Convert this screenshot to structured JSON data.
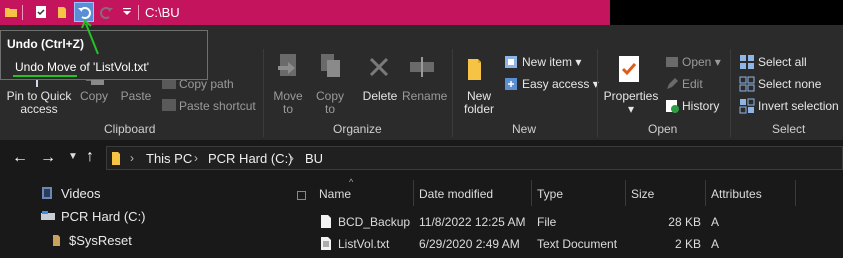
{
  "title_bar": {
    "path": "C:\\BU"
  },
  "tooltip": {
    "title": "Undo (Ctrl+Z)",
    "body_prefix": "Undo Move",
    "body_suffix": " of 'ListVol.txt'"
  },
  "ribbon": {
    "clipboard": {
      "pin_line1": "Pin to Quick",
      "pin_line2": "access",
      "copy": "Copy",
      "paste": "Paste",
      "copy_path": "Copy path",
      "paste_shortcut": "Paste shortcut",
      "group_label": "Clipboard"
    },
    "organize": {
      "move_to_1": "Move",
      "move_to_2": "to",
      "copy_to_1": "Copy",
      "copy_to_2": "to",
      "delete": "Delete",
      "rename": "Rename",
      "group_label": "Organize"
    },
    "new": {
      "new_folder_1": "New",
      "new_folder_2": "folder",
      "new_item": "New item",
      "easy_access": "Easy access",
      "group_label": "New"
    },
    "open": {
      "properties": "Properties",
      "open": "Open",
      "edit": "Edit",
      "history": "History",
      "group_label": "Open"
    },
    "select": {
      "select_all": "Select all",
      "select_none": "Select none",
      "invert_selection": "Invert selection",
      "group_label": "Select"
    }
  },
  "address": {
    "crumbs": [
      "This PC",
      "PCR Hard (C:)",
      "BU"
    ]
  },
  "nav_pane": {
    "items": [
      "Videos",
      "PCR Hard (C:)",
      "$SysReset"
    ]
  },
  "file_list": {
    "columns": [
      "Name",
      "Date modified",
      "Type",
      "Size",
      "Attributes"
    ],
    "rows": [
      {
        "name": "BCD_Backup",
        "date": "11/8/2022 12:25 AM",
        "type": "File",
        "size": "28 KB",
        "attr": "A"
      },
      {
        "name": "ListVol.txt",
        "date": "6/29/2020 2:49 AM",
        "type": "Text Document",
        "size": "2 KB",
        "attr": "A"
      }
    ]
  },
  "colors": {
    "title_bar": "#c4145e",
    "ribbon": "#2b2b2b",
    "background": "#191919",
    "annotation": "#22c322"
  }
}
